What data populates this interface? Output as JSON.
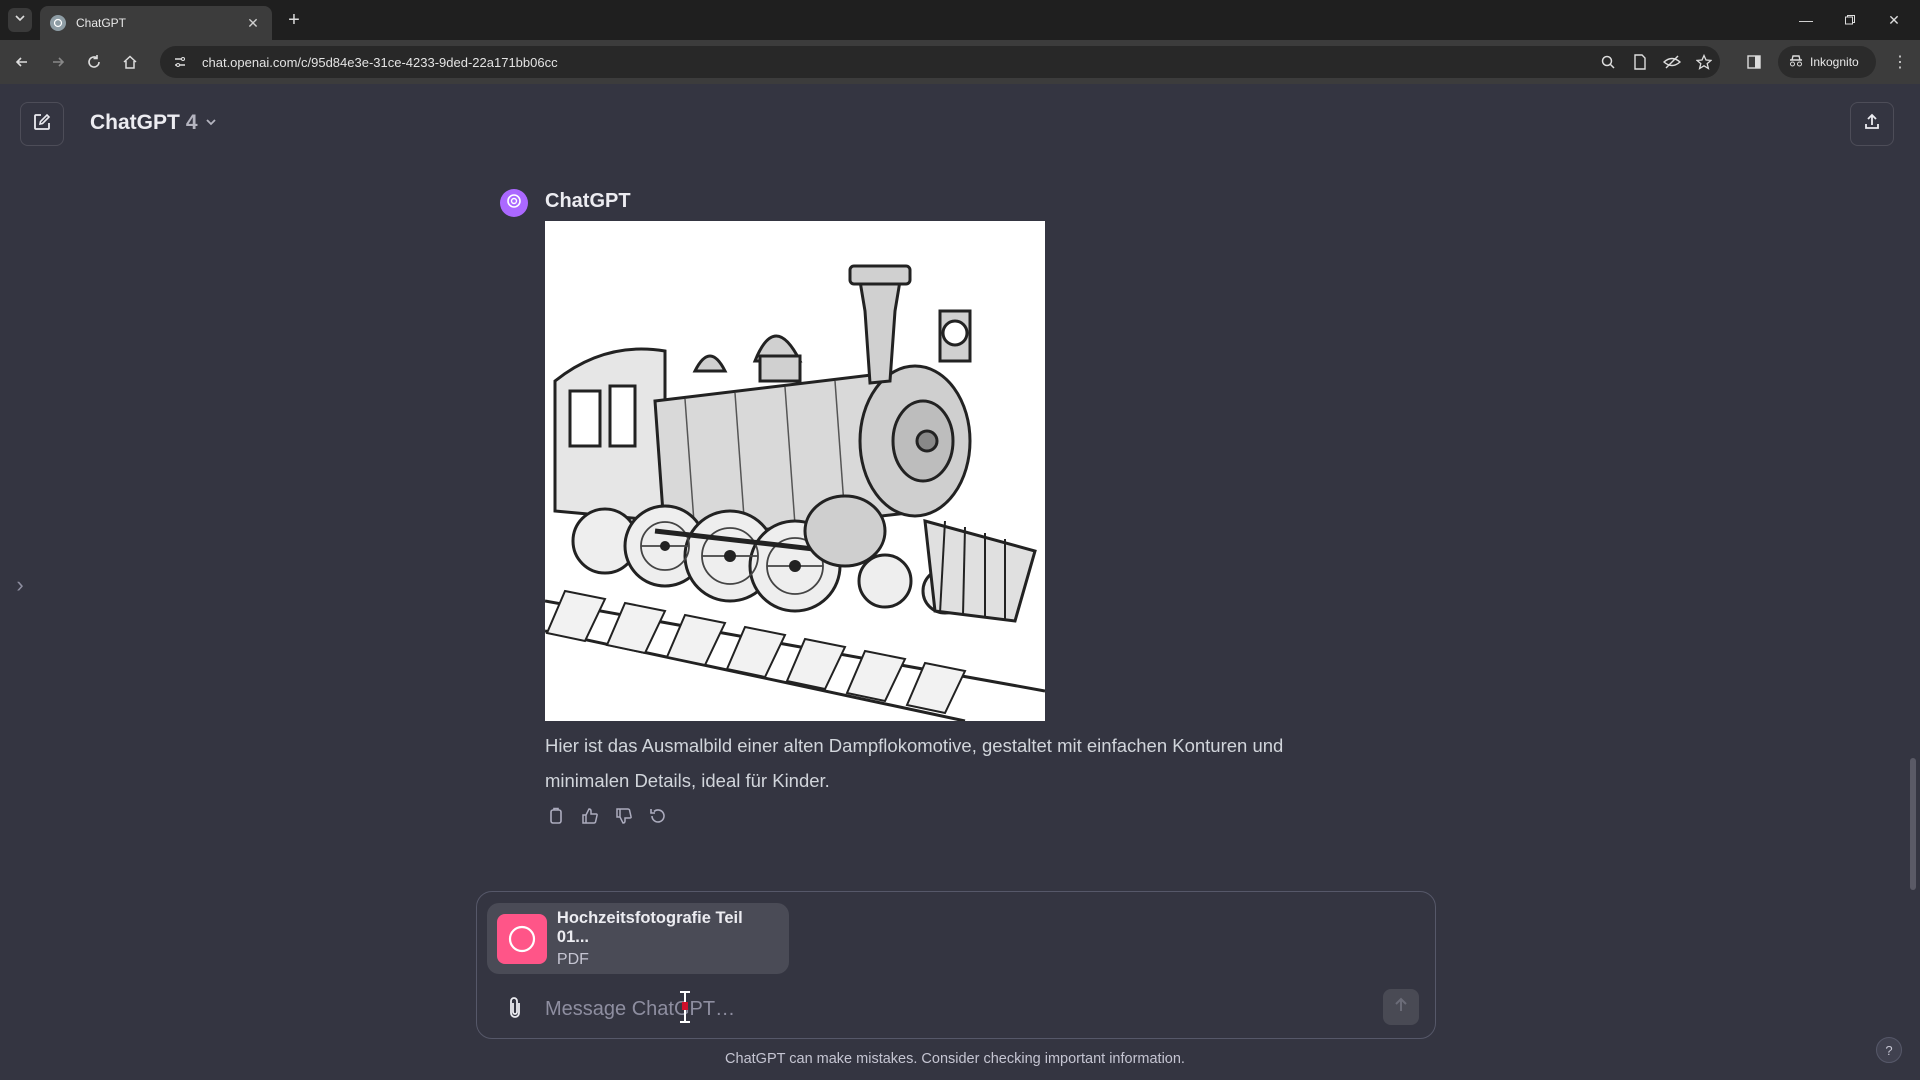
{
  "browser": {
    "tab_title": "ChatGPT",
    "url": "chat.openai.com/c/95d84e3e-31ce-4233-9ded-22a171bb06cc",
    "incognito_label": "Inkognito"
  },
  "header": {
    "model_name": "ChatGPT",
    "model_version": "4"
  },
  "message": {
    "author": "ChatGPT",
    "image_alt": "Steam locomotive coloring page",
    "text": "Hier ist das Ausmalbild einer alten Dampflokomotive, gestaltet mit einfachen Konturen und minimalen Details, ideal für Kinder."
  },
  "composer": {
    "attachment_name": "Hochzeitsfotografie Teil 01...",
    "attachment_type": "PDF",
    "placeholder": "Message ChatGPT…"
  },
  "footer": {
    "disclaimer": "ChatGPT can make mistakes. Consider checking important information.",
    "help_label": "?"
  },
  "colors": {
    "background": "#343541",
    "avatar": "#ab68ff",
    "attachment_icon": "#ff5588"
  }
}
